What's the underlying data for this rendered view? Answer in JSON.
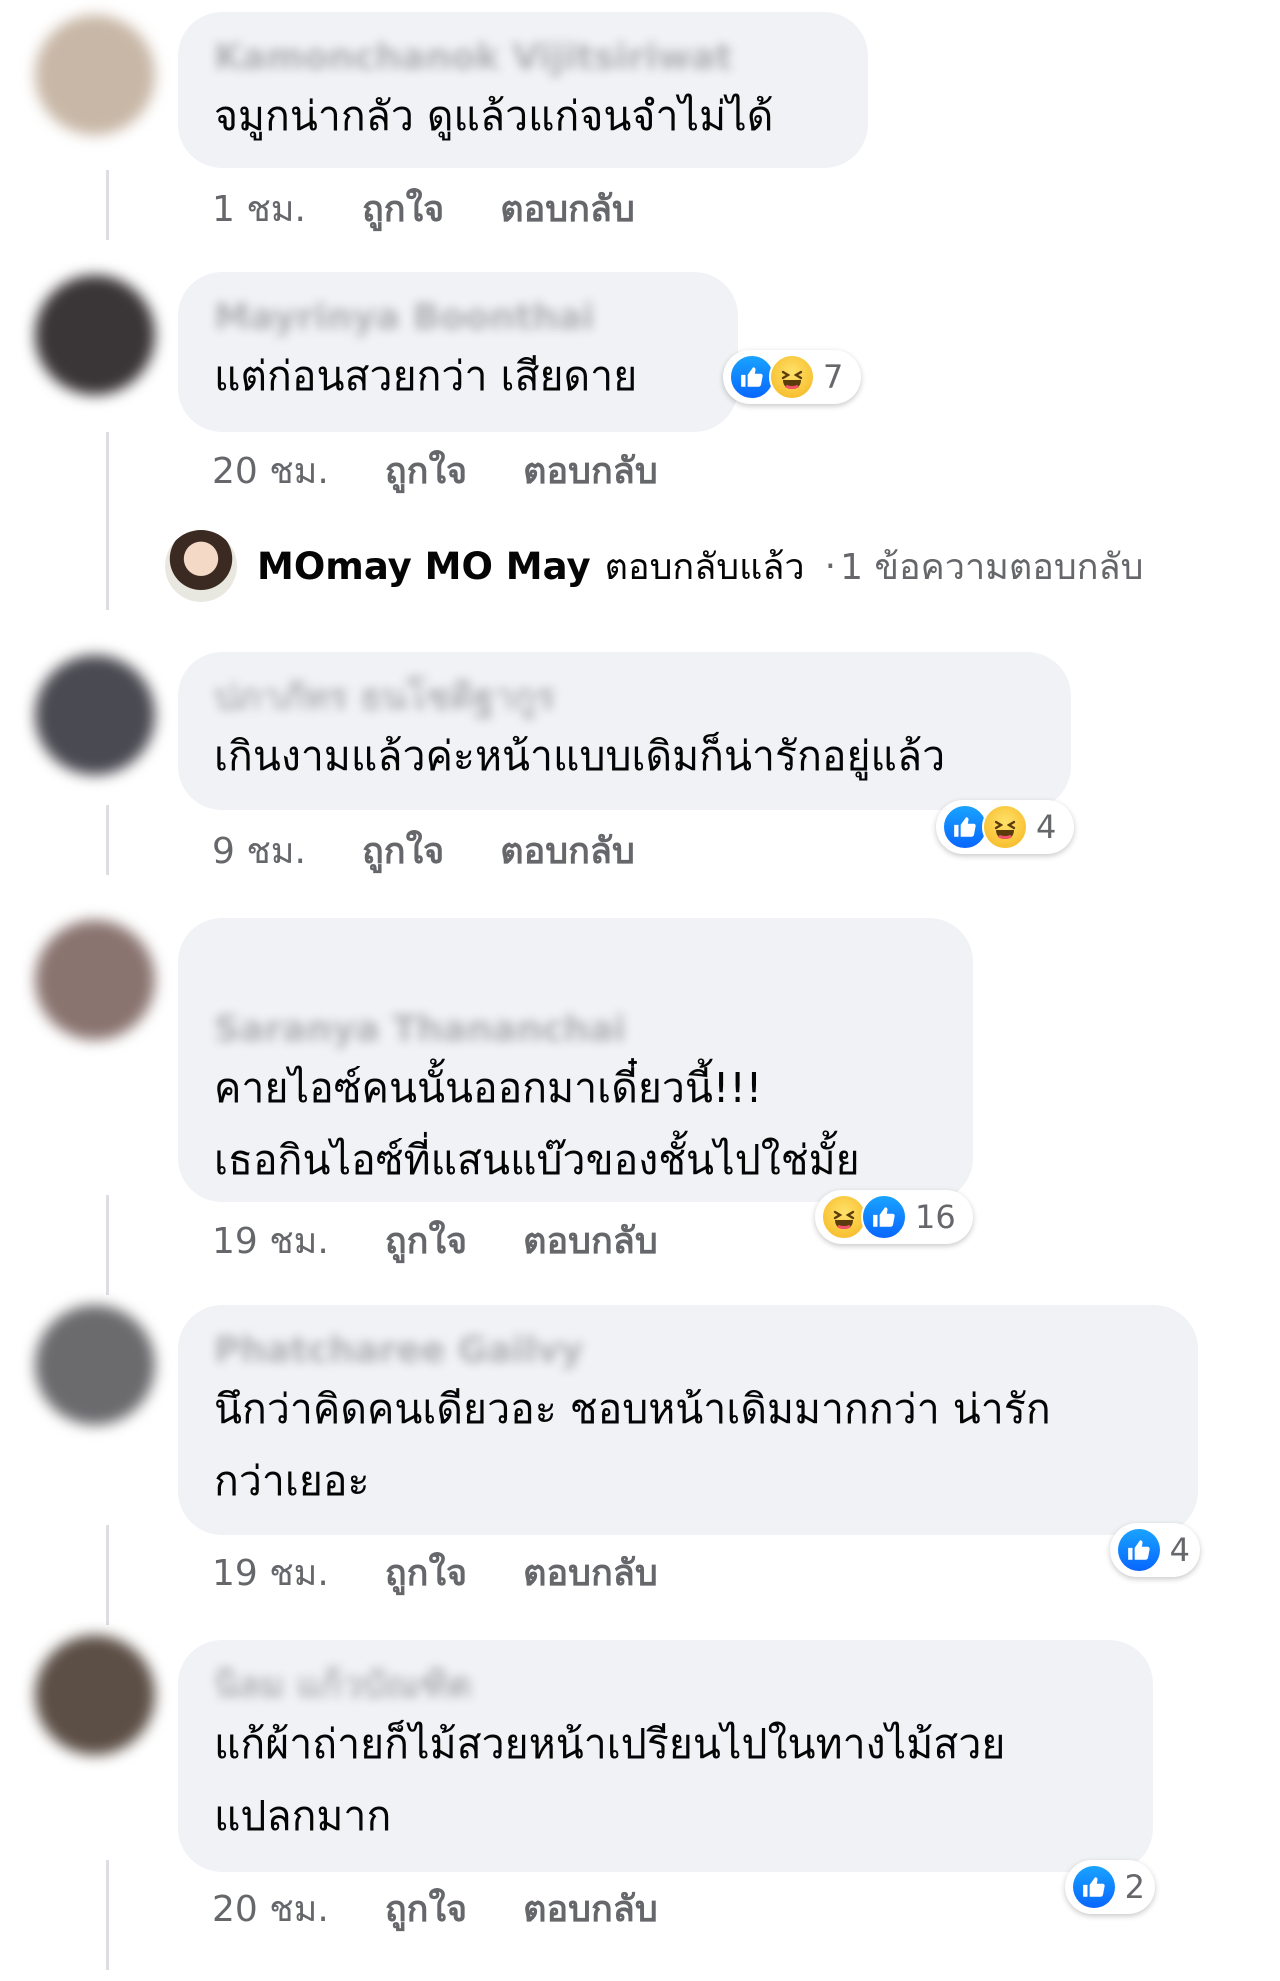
{
  "comments": [
    {
      "author": "Kamonchanok Vijitsiriwat",
      "lines": [
        "จมูกน่ากลัว ดูแล้วแก่จนจำไม่ได้"
      ],
      "time": "1 ชม.",
      "like_label": "ถูกใจ",
      "reply_label": "ตอบกลับ",
      "reaction_count": ""
    },
    {
      "author": "Mayrinya Boonthai",
      "lines": [
        "แต่ก่อนสวยกว่า เสียดาย"
      ],
      "time": "20 ชม.",
      "like_label": "ถูกใจ",
      "reply_label": "ตอบกลับ",
      "reaction_icons": [
        "like-icon",
        "haha-icon"
      ],
      "reaction_count": "7"
    },
    {
      "author": "ปภาภัทร ธนโชติฐากูร",
      "lines": [
        "เกินงามแล้วค่ะหน้าแบบเดิมก็น่ารักอยู่แล้ว"
      ],
      "time": "9 ชม.",
      "like_label": "ถูกใจ",
      "reply_label": "ตอบกลับ",
      "reaction_icons": [
        "like-icon",
        "haha-icon"
      ],
      "reaction_count": "4"
    },
    {
      "author": "Saranya Thananchai",
      "lines": [
        "คายไอซ์คนนั้นออกมาเดี๋ยวนี้!!!",
        "เธอกินไอซ์ที่แสนแบ๊วของชั้นไปใช่มั้ย"
      ],
      "time": "19 ชม.",
      "like_label": "ถูกใจ",
      "reply_label": "ตอบกลับ",
      "reaction_icons": [
        "haha-icon",
        "like-icon"
      ],
      "reaction_count": "16"
    },
    {
      "author": "Phatcharee Gailvy",
      "lines": [
        "นึกว่าคิดคนเดียวอะ  ชอบหน้าเดิมมากกว่า น่ารัก",
        "กว่าเยอะ"
      ],
      "time": "19 ชม.",
      "like_label": "ถูกใจ",
      "reply_label": "ตอบกลับ",
      "reaction_icons": [
        "like-icon"
      ],
      "reaction_count": "4"
    },
    {
      "author": "นิลม แก้วบัณฑิต",
      "lines": [
        "แก้ผ้าถ่ายก็ไม้สวยหน้าเปรียนไปในทางไม้สวย",
        "แปลกมาก"
      ],
      "time": "20 ชม.",
      "like_label": "ถูกใจ",
      "reply_label": "ตอบกลับ",
      "reaction_icons": [
        "like-icon"
      ],
      "reaction_count": "2"
    }
  ],
  "reply_summary": {
    "name": "MOmay MO May",
    "action": "ตอบกลับแล้ว",
    "separator": "·",
    "count_text": "1 ข้อความตอบกลับ"
  },
  "colors": {
    "bubble": "#f0f2f5",
    "meta_text": "#65676b",
    "like_blue": "#0866ff",
    "haha_yellow": "#f7b928"
  }
}
